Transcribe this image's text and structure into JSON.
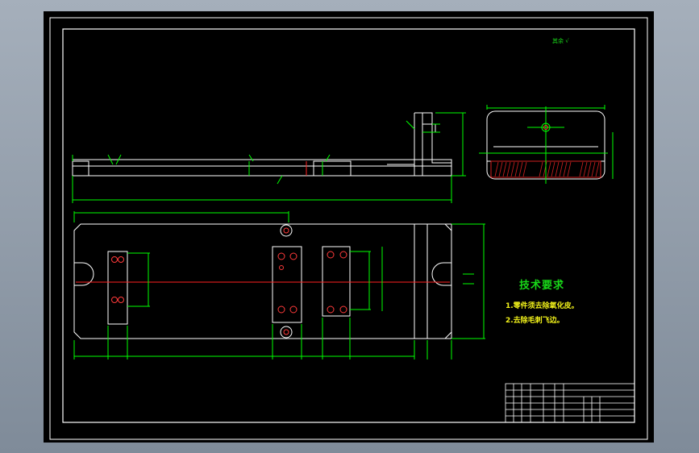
{
  "drawing": {
    "background": "#000000",
    "line_colors": {
      "frame": "#ffffff",
      "outline": "#ffffff",
      "dimension": "#00ff00",
      "centerline": "#ff2020",
      "holes": "#ff3a3a",
      "hatch": "#d02020",
      "tech_text": "#ffff00"
    }
  },
  "tech_requirements": {
    "title": "技术要求",
    "items": [
      "1.零件须去除氧化皮。",
      "2.去除毛刺飞边。"
    ]
  },
  "roughness_note": "其余"
}
